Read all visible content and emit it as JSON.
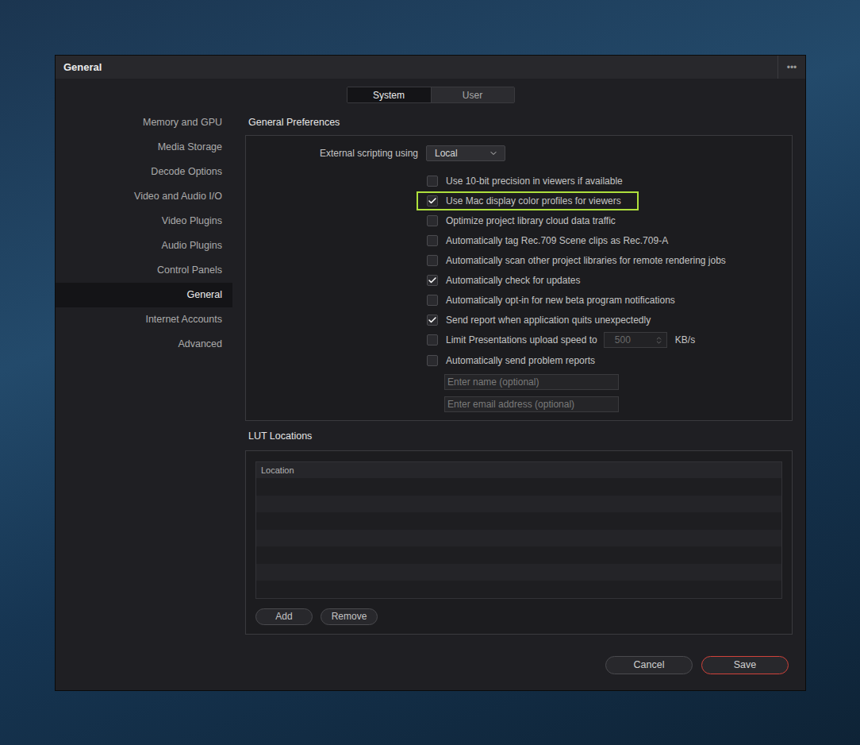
{
  "window": {
    "title": "General",
    "menu": "•••"
  },
  "tabs": [
    {
      "label": "System",
      "selected": true
    },
    {
      "label": "User",
      "selected": false
    }
  ],
  "sidebar": {
    "items": [
      {
        "label": "Memory and GPU",
        "selected": false
      },
      {
        "label": "Media Storage",
        "selected": false
      },
      {
        "label": "Decode Options",
        "selected": false
      },
      {
        "label": "Video and Audio I/O",
        "selected": false
      },
      {
        "label": "Video Plugins",
        "selected": false
      },
      {
        "label": "Audio Plugins",
        "selected": false
      },
      {
        "label": "Control Panels",
        "selected": false
      },
      {
        "label": "General",
        "selected": true
      },
      {
        "label": "Internet Accounts",
        "selected": false
      },
      {
        "label": "Advanced",
        "selected": false
      }
    ]
  },
  "general_preferences": {
    "title": "General Preferences",
    "scripting": {
      "label": "External scripting using",
      "value": "Local"
    },
    "options": [
      {
        "kind": "checkbox",
        "label": "Use 10-bit precision in viewers if available",
        "checked": false,
        "highlighted": false
      },
      {
        "kind": "checkbox",
        "label": "Use Mac display color profiles for viewers",
        "checked": true,
        "highlighted": true
      },
      {
        "kind": "checkbox",
        "label": "Optimize project library cloud data traffic",
        "checked": false,
        "highlighted": false
      },
      {
        "kind": "checkbox",
        "label": "Automatically tag Rec.709 Scene clips as Rec.709-A",
        "checked": false,
        "highlighted": false
      },
      {
        "kind": "checkbox",
        "label": "Automatically scan other project libraries for remote rendering jobs",
        "checked": false,
        "highlighted": false
      },
      {
        "kind": "checkbox",
        "label": "Automatically check for updates",
        "checked": true,
        "highlighted": false
      },
      {
        "kind": "checkbox",
        "label": "Automatically opt-in for new beta program notifications",
        "checked": false,
        "highlighted": false
      },
      {
        "kind": "checkbox",
        "label": "Send report when application quits unexpectedly",
        "checked": true,
        "highlighted": false
      },
      {
        "kind": "checkbox-number",
        "label": "Limit Presentations upload speed to",
        "checked": false,
        "highlighted": false,
        "value": "500",
        "unit": "KB/s",
        "disabled": true
      },
      {
        "kind": "checkbox",
        "label": "Automatically send problem reports",
        "checked": false,
        "highlighted": false
      }
    ],
    "fields": [
      {
        "placeholder": "Enter name (optional)"
      },
      {
        "placeholder": "Enter email address (optional)"
      }
    ]
  },
  "lut_locations": {
    "title": "LUT Locations",
    "columns": [
      "Location"
    ],
    "rows": [],
    "buttons": [
      "Add",
      "Remove"
    ]
  },
  "footer": {
    "buttons": [
      {
        "label": "Cancel",
        "primary": false
      },
      {
        "label": "Save",
        "primary": true
      }
    ]
  }
}
